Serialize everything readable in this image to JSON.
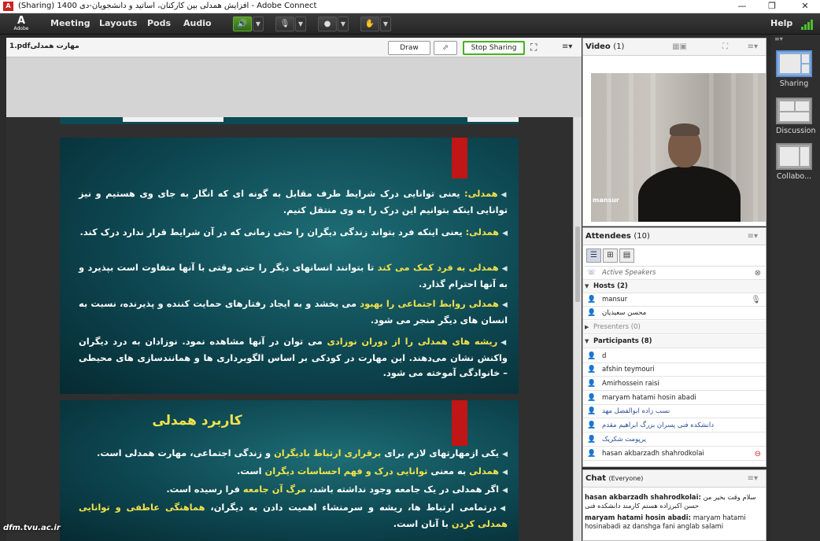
{
  "window": {
    "title": "(Sharing) افزایش همدلی بین کارکنان، اساتید و دانشجویان-دی 1400 - Adobe Connect"
  },
  "menubar": {
    "logo_text": "Adobe",
    "items": [
      "Meeting",
      "Layouts",
      "Pods",
      "Audio"
    ],
    "help": "Help"
  },
  "share": {
    "file_name": "1.pdfمهارت همدلی",
    "draw_label": "Draw",
    "stop_label": "Stop Sharing",
    "slide1": {
      "bullets": [
        {
          "parts": [
            {
              "t": "همدلی:",
              "hl": true
            },
            {
              "t": " یعنی توانایی درک شرایط طرف مقابل به گونه ای که انگار به جای وی هستیم و نیز توانایی اینکه بتوانیم این درک را به وی منتقل کنیم.",
              "hl": false
            }
          ]
        },
        {
          "parts": [
            {
              "t": "همدلی:",
              "hl": true
            },
            {
              "t": " یعنی اینکه فرد بتواند زندگی دیگران را حتی زمانی که در آن شرایط قرار ندارد درک کند.",
              "hl": false
            }
          ]
        },
        {
          "parts": [
            {
              "t": "همدلی به فرد کمک می کند",
              "hl": true
            },
            {
              "t": " تا بتوانند انسانهای دیگر را حتی وقتی با آنها متفاوت است بپذیرد و به آنها احترام گذارد.",
              "hl": false
            }
          ]
        },
        {
          "parts": [
            {
              "t": "همدلی روابط اجتماعی را بهبود",
              "hl": true
            },
            {
              "t": " می بخشد و به ایجاد رفتارهای حمایت کننده و پذیرنده، نسبت به انسان های دیگر منجر می شود.",
              "hl": false
            }
          ]
        },
        {
          "parts": [
            {
              "t": "ریشه های همدلی را از دوران نوزادی",
              "hl": true
            },
            {
              "t": " می توان در آنها مشاهده نمود. نوزادان به درد دیگران واکنش نشان می‌دهند. این مهارت در کودکی بر اساس الگوبرداری ها و همانندسازی های محیطی – خانوادگی آموخته می شود.",
              "hl": false
            }
          ]
        }
      ]
    },
    "slide2": {
      "title": "کاربرد همدلی",
      "bullets": [
        {
          "parts": [
            {
              "t": "یکی ازمهارتهای لازم برای ",
              "hl": false
            },
            {
              "t": "برقراری ارتباط بادیگران",
              "hl": true
            },
            {
              "t": " و زندگی اجتماعی، مهارت همدلی است.",
              "hl": false
            }
          ]
        },
        {
          "parts": [
            {
              "t": "همدلی",
              "hl": true
            },
            {
              "t": " به معنی ",
              "hl": false
            },
            {
              "t": "توانایی درک و فهم احساسات دیگران",
              "hl": true
            },
            {
              "t": " است.",
              "hl": false
            }
          ]
        },
        {
          "parts": [
            {
              "t": "اگر همدلی در یک جامعه وجود نداشته باشد، ",
              "hl": false
            },
            {
              "t": "مرگ آن جامعه",
              "hl": true
            },
            {
              "t": " فرا رسیده است.",
              "hl": false
            }
          ]
        },
        {
          "parts": [
            {
              "t": "درتمامی ارتباط ها، ریشه و سرمنشاء اهمیت دادن به دیگران، ",
              "hl": false
            },
            {
              "t": "هماهنگی عاطفی و توانایی همدلی کردن",
              "hl": true
            },
            {
              "t": " با آنان است.",
              "hl": false
            }
          ]
        }
      ]
    }
  },
  "watermark": "dfm.tvu.ac.ir",
  "video": {
    "title": "Video",
    "count": "(1)",
    "speaker": "mansur"
  },
  "attendees": {
    "title": "Attendees",
    "count": "(10)",
    "active_speakers": "Active Speakers",
    "hosts_label": "Hosts (2)",
    "hosts": [
      "mansur",
      "محسن سعیدیان"
    ],
    "presenters_label": "Presenters (0)",
    "participants_label": "Participants (8)",
    "participants": [
      "d",
      "afshin teymouri",
      "Amirhossein raisi",
      "maryam hatami hosin abadi",
      "نسب زاده ابوالفضل مهد",
      "دانشکده فنی پسران بزرگ ابراهیم مقدم",
      "یرپومت شکریک",
      "hasan akbarzadh shahrodkolai"
    ]
  },
  "chat": {
    "title": "Chat",
    "scope": "(Everyone)",
    "messages": [
      {
        "from": "hasan akbarzadh shahrodkolai:",
        "text": "سلام وقت بخیر من حسن اکبرزاده هستم کارمند دانشکده فنی"
      },
      {
        "from": "maryam hatami hosin abadi:",
        "text": "maryam hatami hosinabadi az danshga fani anglab salami"
      }
    ]
  },
  "layouts": [
    {
      "label": "Sharing",
      "selected": true
    },
    {
      "label": "Discussion",
      "selected": false
    },
    {
      "label": "Collabo...",
      "selected": false
    }
  ]
}
